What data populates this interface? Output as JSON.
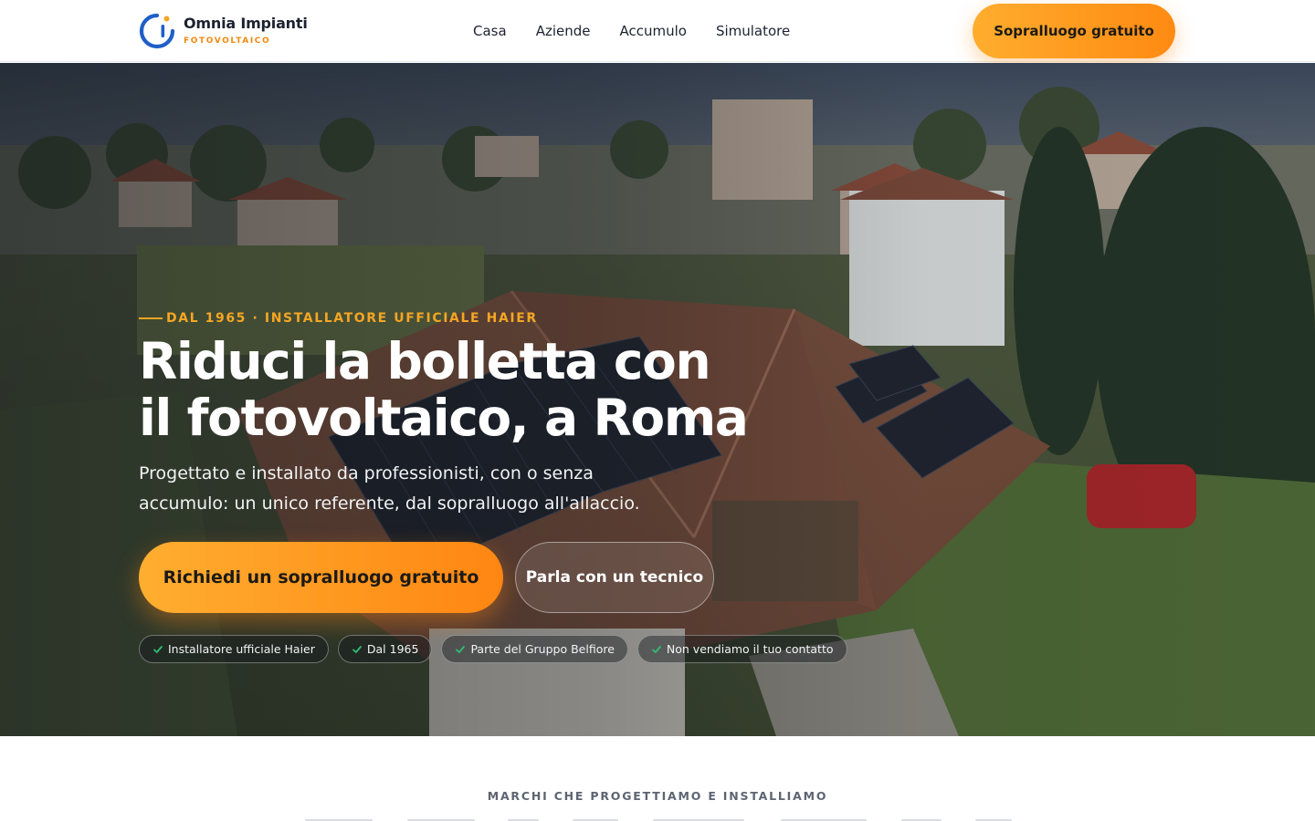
{
  "header": {
    "brand_name": "Omnia Impianti",
    "brand_sub": "FOTOVOLTAICO",
    "nav": [
      "Casa",
      "Aziende",
      "Accumulo",
      "Simulatore"
    ],
    "cta": "Sopralluogo gratuito"
  },
  "hero": {
    "eyebrow": "DAL 1965 · INSTALLATORE UFFICIALE HAIER",
    "title_line1": "Riduci la bolletta con",
    "title_line2": "il fotovoltaico, a Roma",
    "subtitle_line1": "Progettato e installato da professionisti, con o senza",
    "subtitle_line2": "accumulo: un unico referente, dal sopralluogo all'allaccio.",
    "primary_cta": "Richiedi un sopralluogo gratuito",
    "secondary_cta": "Parla con un tecnico",
    "badges": [
      "Installatore ufficiale Haier",
      "Dal 1965",
      "Parte del Gruppo Belfiore",
      "Non vendiamo il tuo contatto"
    ]
  },
  "brands": {
    "title": "MARCHI CHE PROGETTIAMO E INSTALLIAMO"
  },
  "colors": {
    "accent": "#ff8a12",
    "accent_light": "#ffad2e",
    "brand_blue": "#1f5fc8",
    "eyebrow": "#f5a623",
    "check": "#2fbf71"
  },
  "icons": {
    "logo": "circular-c-logo-icon",
    "badge": "check-icon"
  }
}
